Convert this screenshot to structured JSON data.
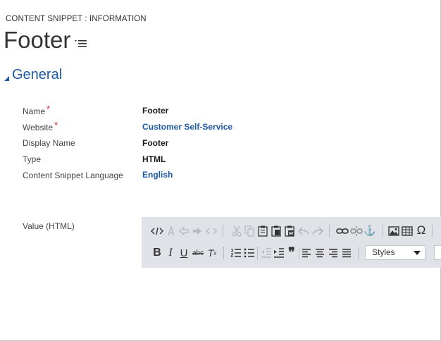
{
  "header": {
    "entity_label": "CONTENT SNIPPET : INFORMATION",
    "record_title": "Footer"
  },
  "section": {
    "title": "General"
  },
  "fields": [
    {
      "label": "Name",
      "required": true,
      "value": "Footer",
      "is_link": false
    },
    {
      "label": "Website",
      "required": true,
      "value": "Customer Self-Service",
      "is_link": true
    },
    {
      "label": "Display Name",
      "required": false,
      "value": "Footer",
      "is_link": false
    },
    {
      "label": "Type",
      "required": false,
      "value": "HTML",
      "is_link": false
    },
    {
      "label": "Content Snippet Language",
      "required": false,
      "value": "English",
      "is_link": true
    }
  ],
  "value_field": {
    "label": "Value (HTML)"
  },
  "editor": {
    "required_marker": "*",
    "bold": "B",
    "italic": "I",
    "underline": "U",
    "strike": "abc",
    "clear_format": "T",
    "clear_format_sub": "x",
    "quote": "❞",
    "omega": "Ω",
    "anchor": "⚓",
    "styles_label": "Styles"
  },
  "colors": {
    "accent": "#1d5aa6",
    "required": "#e02020",
    "toolbar_bg": "#dfe3e8"
  }
}
